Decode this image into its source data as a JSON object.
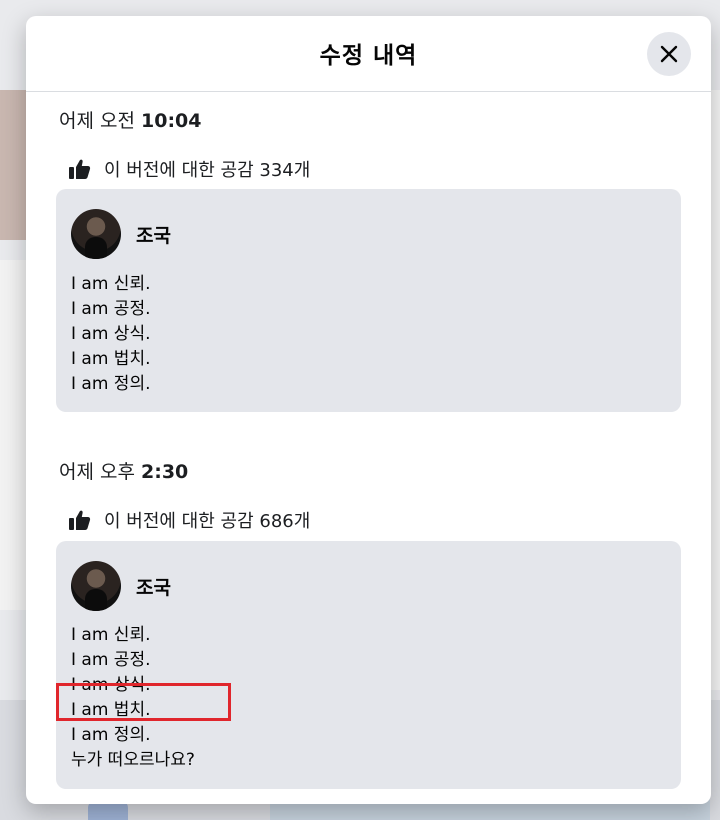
{
  "modal": {
    "title": "수정 내역",
    "close_icon": "close-icon"
  },
  "versions": [
    {
      "timestamp_prefix": "어제 오전",
      "timestamp_time": "10:04",
      "likes_text": "이 버전에 대한 공감 334개",
      "author": "조국",
      "lines": [
        "I am 신뢰.",
        "I am 공정.",
        "I am 상식.",
        "I am 법치.",
        "I am 정의."
      ]
    },
    {
      "timestamp_prefix": "어제 오후",
      "timestamp_time": "2:30",
      "likes_text": "이 버전에 대한 공감 686개",
      "author": "조국",
      "lines": [
        "I am 신뢰.",
        "I am 공정.",
        "I am 상식.",
        "I am 법치.",
        "I am 정의.",
        "누가 떠오르나요?"
      ]
    }
  ],
  "icons": {
    "like": "thumbs-up-icon",
    "close": "close-icon"
  },
  "colors": {
    "card_bg": "#e4e6eb",
    "highlight_border": "#e0262c"
  }
}
